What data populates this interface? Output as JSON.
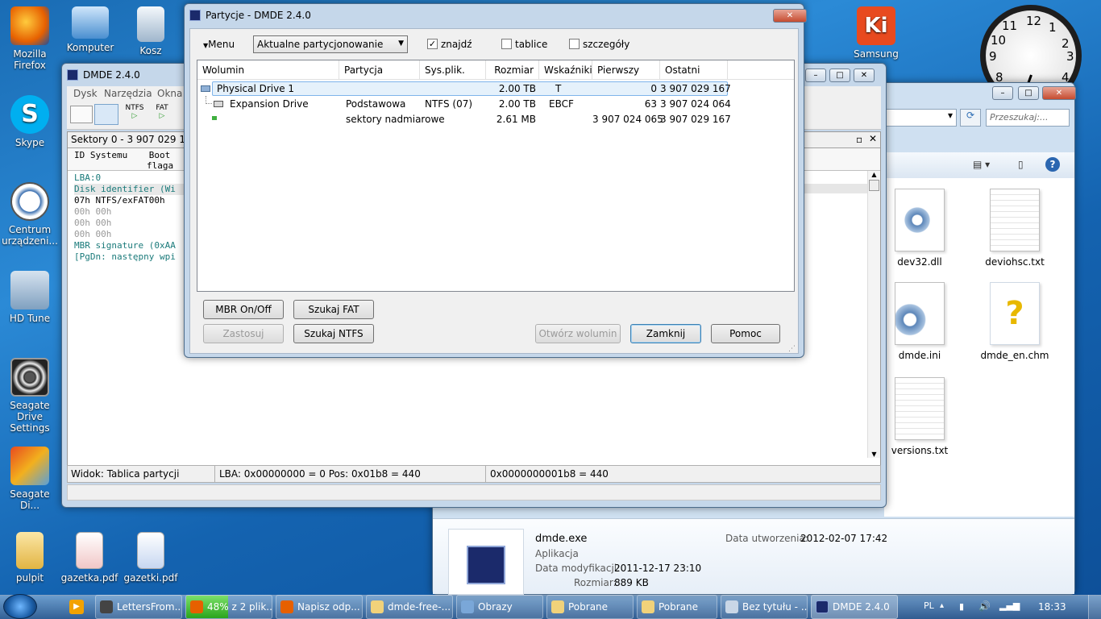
{
  "desktop": {
    "icons": [
      {
        "label": "Mozilla\nFirefox",
        "color": "#e66000"
      },
      {
        "label": "Komputer",
        "color": "#4a8fd0"
      },
      {
        "label": "Kosz",
        "color": "#c8d8e8"
      },
      {
        "label": "Skype",
        "color": "#00aff0"
      },
      {
        "label": "Centrum\nurządzeni...",
        "color": "#eeeeee"
      },
      {
        "label": "HD Tune",
        "color": "#7fa0c0"
      },
      {
        "label": "Seagate Drive\nSettings",
        "color": "#222222"
      },
      {
        "label": "Seagate Di...",
        "color": "#d0d0d0"
      },
      {
        "label": "pulpit",
        "color": "#f1d27a"
      },
      {
        "label": "gazetka.pdf",
        "color": "#ffffff"
      },
      {
        "label": "gazetki.pdf",
        "color": "#ffffff"
      },
      {
        "label": "Samsung",
        "color": "#e84a1f"
      }
    ]
  },
  "clock": {
    "numbers": [
      "12",
      "1",
      "2",
      "3",
      "4",
      "8",
      "9",
      "10",
      "11"
    ]
  },
  "dmde_main": {
    "title": "DMDE 2.4.0",
    "menu": [
      "Dysk",
      "Narzędzia",
      "Okna"
    ],
    "toolbar": {
      "ntfs": "NTFS",
      "fat": "FAT"
    },
    "sectors": "Sektory 0 - 3 907 029 167",
    "col_headers": [
      "ID Systemu",
      "Boot",
      "flaga"
    ],
    "hex_lines": [
      "LBA:0",
      "Disk identifier (Wi",
      "07h NTFS/exFAT00h",
      "00h         00h",
      "00h         00h",
      "00h         00h",
      "MBR signature (0xAA",
      "[PgDn: następny wpi"
    ],
    "status": {
      "view": "Widok: Tablica partycji",
      "lba": "LBA: 0x00000000 = 0  Pos: 0x01b8 = 440",
      "offset": "0x0000000001b8 = 440"
    }
  },
  "dialog": {
    "title": "Partycje - DMDE 2.4.0",
    "menu_label": "Menu",
    "dropdown_value": "Aktualne partycjonowanie",
    "checks": [
      {
        "label": "znajdź",
        "checked": true
      },
      {
        "label": "tablice",
        "checked": false
      },
      {
        "label": "szczegóły",
        "checked": false
      }
    ],
    "columns": [
      "Wolumin",
      "Partycja",
      "Sys.plik.",
      "Rozmiar",
      "Wskaźniki",
      "Pierwszy se...",
      "Ostatni sekt..."
    ],
    "rows": [
      {
        "wolumin": "Physical Drive 1",
        "partycja": "",
        "sys": "",
        "rozmiar": "2.00 TB",
        "wsk": "T",
        "first": "0",
        "last": "3 907 029 167"
      },
      {
        "wolumin": "Expansion Drive",
        "partycja": "Podstawowa",
        "sys": "NTFS (07)",
        "rozmiar": "2.00 TB",
        "wsk": "EBCF",
        "first": "63",
        "last": "3 907 024 064"
      },
      {
        "wolumin": "",
        "partycja": "sektory nadmiarowe",
        "sys": "",
        "rozmiar": "2.61 MB",
        "wsk": "",
        "first": "3 907 024 065",
        "last": "3 907 029 167"
      }
    ],
    "buttons": {
      "mbr": "MBR On/Off",
      "fat": "Szukaj FAT",
      "apply": "Zastosuj",
      "ntfs": "Szukaj NTFS",
      "open": "Otwórz wolumin",
      "close": "Zamknij",
      "help": "Pomoc"
    }
  },
  "explorer": {
    "search_placeholder": "Przeszukaj:...",
    "files": [
      "dev32.dll",
      "deviohsc.txt",
      "dmde.ini",
      "dmde_en.chm",
      "versions.txt"
    ],
    "details": {
      "name": "dmde.exe",
      "type": "Aplikacja",
      "mod_label": "Data modyfikacji:",
      "mod": "2011-12-17 23:10",
      "size_label": "Rozmiar:",
      "size": "889 KB",
      "created_label": "Data utworzenia:",
      "created": "2012-02-07 17:42"
    }
  },
  "taskbar": {
    "items": [
      "LettersFrom...",
      "48% z 2 plik...",
      "Napisz odp...",
      "dmde-free-...",
      "Obrazy",
      "Pobrane",
      "Pobrane",
      "Bez tytułu - ...",
      "DMDE 2.4.0"
    ],
    "lang": "PL",
    "time": "18:33"
  }
}
